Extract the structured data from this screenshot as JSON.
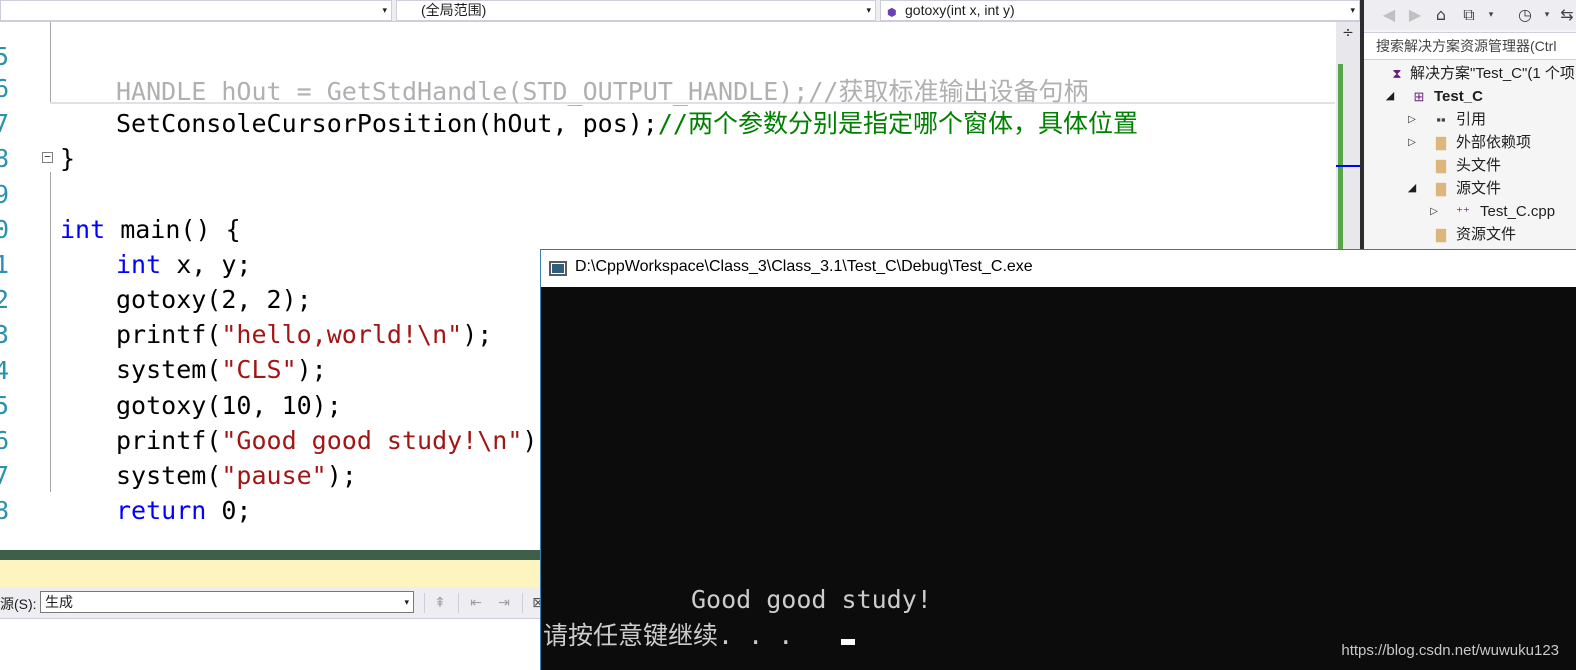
{
  "navbar": {
    "project_combo": "",
    "scope_combo": "(全局范围)",
    "member_combo": "gotoxy(int x, int y)",
    "arrow": "▾"
  },
  "editor": {
    "lines": [
      {
        "num": "5",
        "hidden_text": "HANDLE hOut = GetStdHandle(STD_OUTPUT_HANDLE);//获取标准输出设备句柄"
      },
      {
        "num": "6",
        "code": "SetConsoleCursorPosition(hOut, pos);",
        "comment": "//两个参数分别是指定哪个窗体，具体位置"
      },
      {
        "num": "7",
        "code": "}"
      },
      {
        "num": "8",
        "code": ""
      },
      {
        "num": "9",
        "kw": "int",
        "code": " main() {"
      },
      {
        "num": "0",
        "kw": "int",
        "code": " x, y;"
      },
      {
        "num": "1",
        "code": "gotoxy(2, 2);"
      },
      {
        "num": "2",
        "fn": "printf(",
        "str": "\"hello,world!\\n\"",
        "tail": ");"
      },
      {
        "num": "3",
        "fn": "system(",
        "str": "\"CLS\"",
        "tail": ");"
      },
      {
        "num": "4",
        "code": "gotoxy(10, 10);"
      },
      {
        "num": "5",
        "fn": "printf(",
        "str": "\"Good good study!\\n\"",
        "tail": ");"
      },
      {
        "num": "6",
        "fn": "system(",
        "str": "\"pause\"",
        "tail": ");"
      },
      {
        "num": "7",
        "kw": "return",
        "code": " 0;"
      },
      {
        "num": "8",
        "code": "}"
      },
      {
        "num": "9",
        "code": ""
      }
    ],
    "collapse_glyph": "−",
    "split_glyph": "÷"
  },
  "output": {
    "source_label": "源(S):",
    "source_value": "生成",
    "arrow": "▾"
  },
  "solution_explorer": {
    "search_placeholder": "搜索解决方案资源管理器(Ctrl",
    "solution_label": "解决方案\"Test_C\"(1 个项",
    "project_label": "Test_C",
    "references": "引用",
    "external_deps": "外部依赖项",
    "header_files": "头文件",
    "source_files": "源文件",
    "source_file_item": "Test_C.cpp",
    "resource_files": "资源文件"
  },
  "console": {
    "title": "D:\\CppWorkspace\\Class_3\\Class_3.1\\Test_C\\Debug\\Test_C.exe",
    "output_line": "Good good study!",
    "pause_line": "请按任意键继续. . .",
    "watermark": "https://blog.csdn.net/wuwuku123"
  },
  "colors": {
    "keyword": "#0000ff",
    "string": "#a31515",
    "comment": "#008000",
    "line_number": "#2b91af",
    "console_bg": "#0c0c0c"
  }
}
